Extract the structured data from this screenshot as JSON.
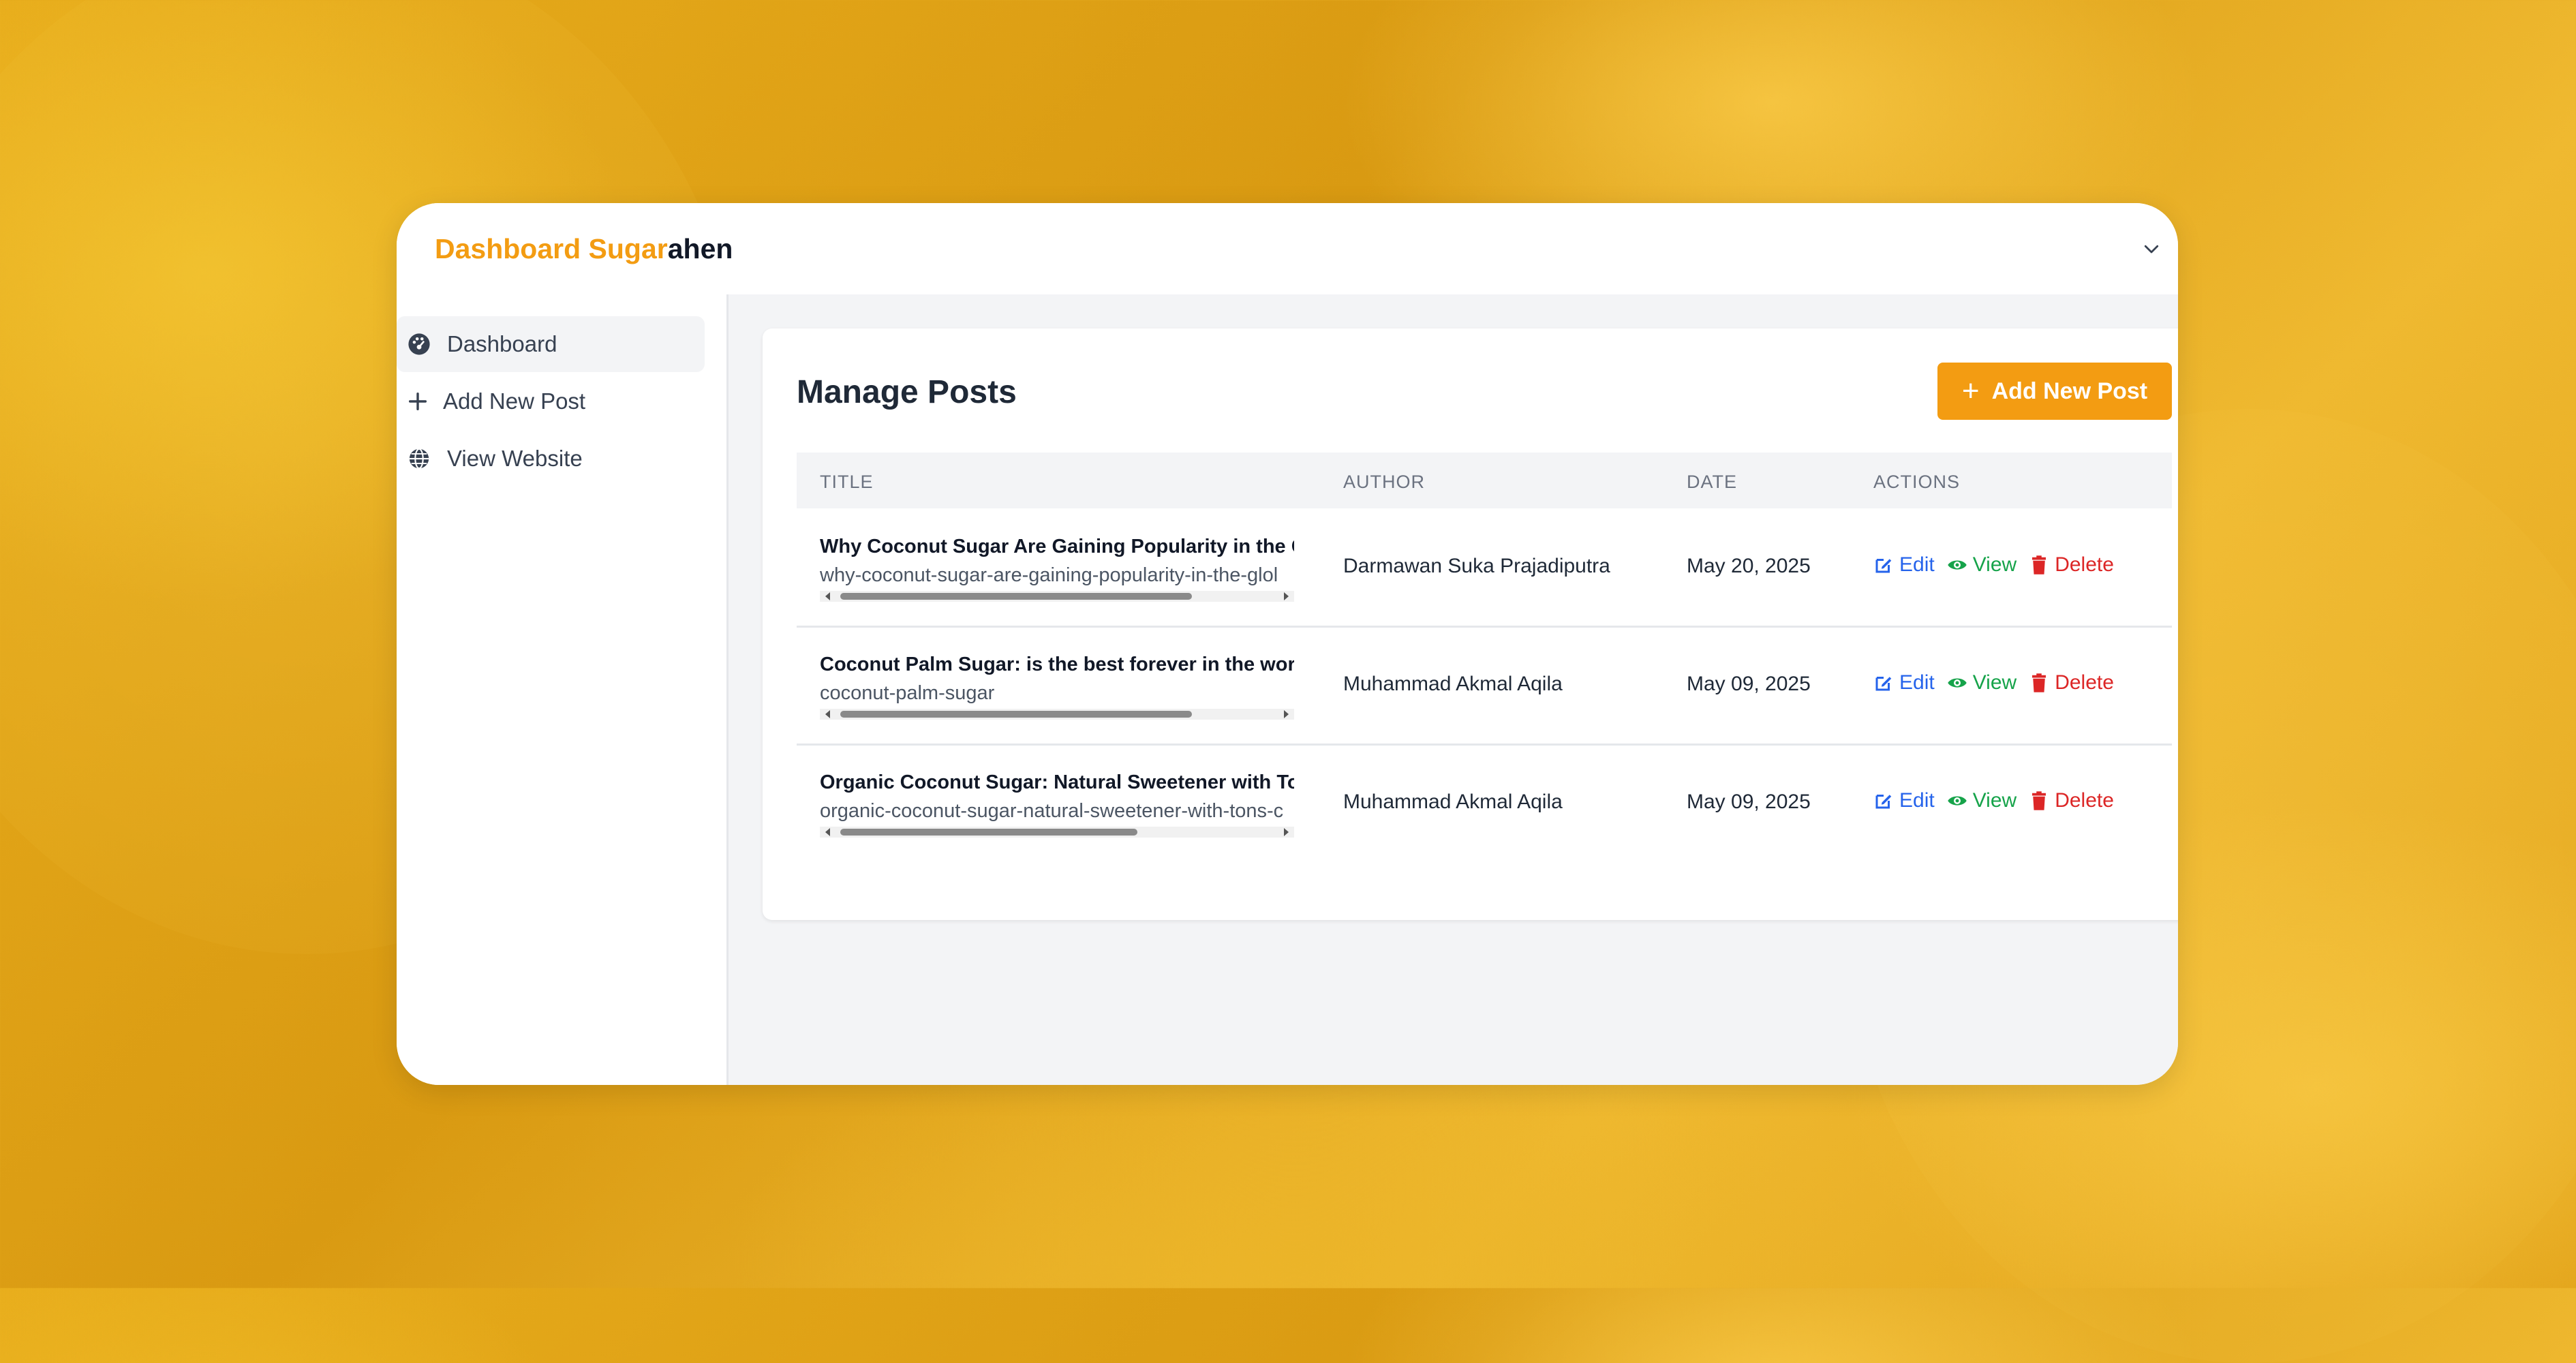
{
  "app": {
    "brand_part1": "Dashboard Sugar",
    "brand_part2": "ahen"
  },
  "sidebar": {
    "items": [
      {
        "label": "Dashboard",
        "icon": "dashboard-icon",
        "active": true
      },
      {
        "label": "Add New Post",
        "icon": "plus-icon",
        "active": false
      },
      {
        "label": "View Website",
        "icon": "globe-icon",
        "active": false
      }
    ]
  },
  "main": {
    "title": "Manage Posts",
    "add_button": "Add New Post",
    "columns": [
      "TITLE",
      "AUTHOR",
      "DATE",
      "ACTIONS"
    ],
    "rows": [
      {
        "title": "Why Coconut Sugar Are Gaining Popularity in the Glo",
        "slug": "why-coconut-sugar-are-gaining-popularity-in-the-glol",
        "author": "Darmawan Suka Prajadiputra",
        "date": "May 20, 2025"
      },
      {
        "title": "Coconut Palm Sugar: is the best forever in the world",
        "slug": "coconut-palm-sugar",
        "author": "Muhammad Akmal Aqila",
        "date": "May 09, 2025"
      },
      {
        "title": "Organic Coconut Sugar: Natural Sweetener with Tons",
        "slug": "organic-coconut-sugar-natural-sweetener-with-tons-c",
        "author": "Muhammad Akmal Aqila",
        "date": "May 09, 2025"
      }
    ],
    "actions": {
      "edit": "Edit",
      "view": "View",
      "delete": "Delete"
    }
  },
  "colors": {
    "brand_accent": "#f39c12",
    "edit": "#2563eb",
    "view": "#16a34a",
    "delete": "#dc2626"
  }
}
